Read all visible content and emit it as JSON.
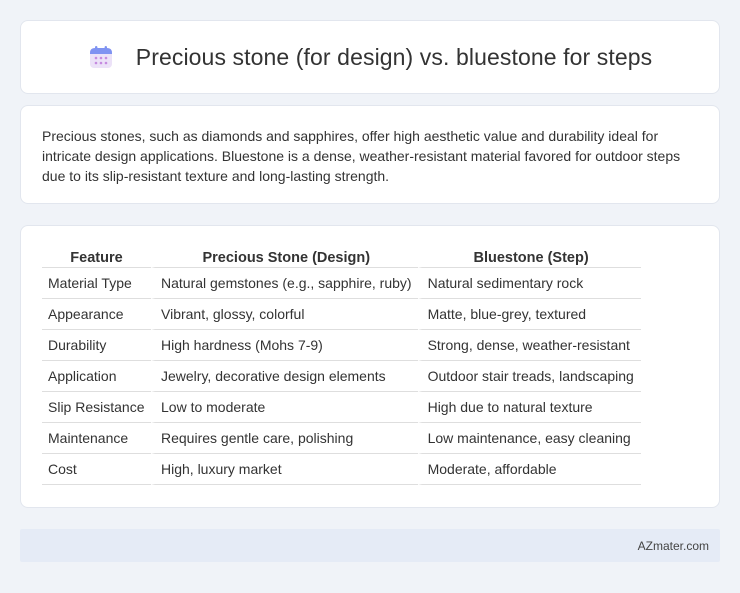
{
  "header": {
    "title": "Precious stone (for design) vs. bluestone for steps",
    "icon": "calendar-icon"
  },
  "intro": {
    "text": "Precious stones, such as diamonds and sapphires, offer high aesthetic value and durability ideal for intricate design applications. Bluestone is a dense, weather-resistant material favored for outdoor steps due to its slip-resistant texture and long-lasting strength."
  },
  "table": {
    "headers": [
      "Feature",
      "Precious Stone (Design)",
      "Bluestone (Step)"
    ],
    "rows": [
      [
        "Material Type",
        "Natural gemstones (e.g., sapphire, ruby)",
        "Natural sedimentary rock"
      ],
      [
        "Appearance",
        "Vibrant, glossy, colorful",
        "Matte, blue-grey, textured"
      ],
      [
        "Durability",
        "High hardness (Mohs 7-9)",
        "Strong, dense, weather-resistant"
      ],
      [
        "Application",
        "Jewelry, decorative design elements",
        "Outdoor stair treads, landscaping"
      ],
      [
        "Slip Resistance",
        "Low to moderate",
        "High due to natural texture"
      ],
      [
        "Maintenance",
        "Requires gentle care, polishing",
        "Low maintenance, easy cleaning"
      ],
      [
        "Cost",
        "High, luxury market",
        "Moderate, affordable"
      ]
    ]
  },
  "footer": {
    "text": "AZmater.com"
  },
  "colors": {
    "background": "#f0f3f8",
    "card": "#ffffff",
    "footer_bg": "#e5ebf6",
    "icon_top": "#7b8ff0",
    "icon_body": "#e9ddf6"
  }
}
